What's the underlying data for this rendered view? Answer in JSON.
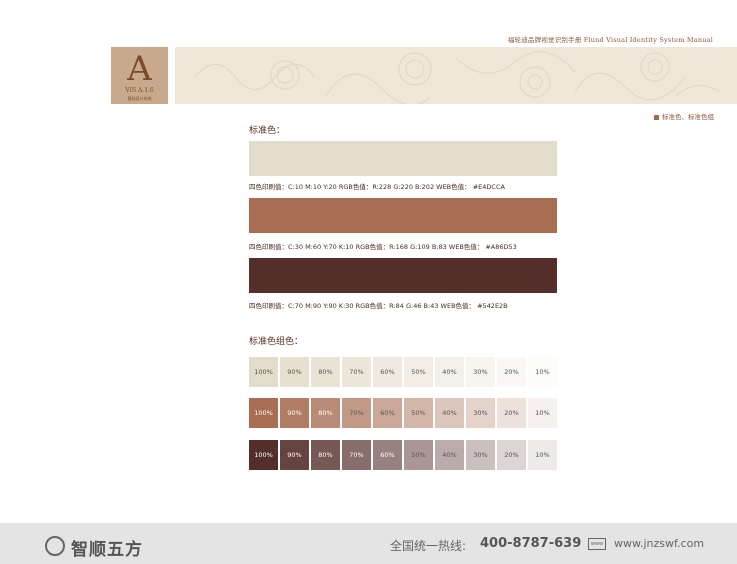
{
  "header": {
    "manual_title": "福轮迪品牌视觉识别手册  Flund Visual Identity System Manual",
    "logo_letter": "A",
    "logo_code": "VIS  A.1.6",
    "logo_subtitle": "基础设计系统",
    "section_tag": "标准色、标准色组"
  },
  "standard_colors": {
    "heading": "标准色：",
    "swatches": [
      {
        "hex": "#E4DCCA",
        "spec": "四色印刷值：C:10  M:10 Y:20    RGB色值：R:228 G:220 B:202  WEB色值：  #E4DCCA"
      },
      {
        "hex": "#A86D53",
        "spec": "四色印刷值：C:30  M:60 Y:70 K:10   RGB色值：R:168 G:109 B:83  WEB色值：  #A86D53"
      },
      {
        "hex": "#542E2B",
        "spec": "四色印刷值：C:70 M:90 Y:90 K:30   RGB色值：R:84 G:46 B:43  WEB色值：  #542E2B"
      }
    ]
  },
  "color_groups": {
    "heading": "标准色组色：",
    "labels": [
      "100%",
      "90%",
      "80%",
      "70%",
      "60%",
      "50%",
      "40%",
      "30%",
      "20%",
      "10%"
    ],
    "rows": [
      {
        "base": "#E4DCCA",
        "label_color": "#555555"
      },
      {
        "base": "#A86D53",
        "label_color": "#ffffff"
      },
      {
        "base": "#542E2B",
        "label_color": "#ffffff"
      }
    ]
  },
  "footer": {
    "brand_name": "智顺五方",
    "hotline_label": "全国统一热线:",
    "hotline_number": "400-8787-639",
    "www_icon": "www-icon",
    "website": "www.jnzswf.com"
  }
}
